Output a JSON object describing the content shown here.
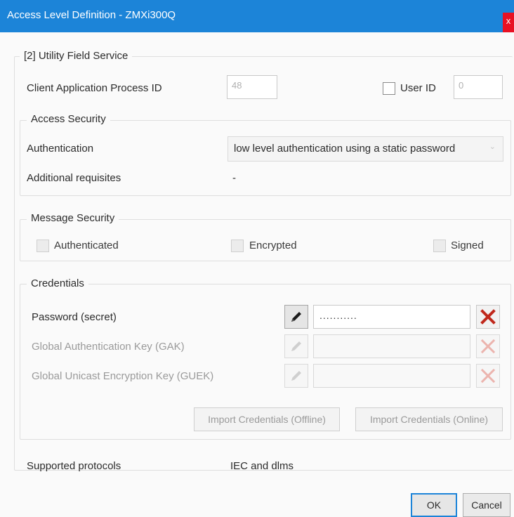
{
  "window": {
    "title": "Access Level Definition - ZMXi300Q",
    "close_symbol": "x"
  },
  "group_main": {
    "legend": "[2] Utility Field Service"
  },
  "client_app": {
    "label": "Client Application Process ID",
    "value": "48"
  },
  "user_id": {
    "label": "User ID",
    "value": "0",
    "checked": false
  },
  "access_security": {
    "legend": "Access Security",
    "authentication_label": "Authentication",
    "authentication_value": "low level authentication using a static password",
    "requisites_label": "Additional requisites",
    "requisites_value": "-"
  },
  "message_security": {
    "legend": "Message Security",
    "authenticated": "Authenticated",
    "encrypted": "Encrypted",
    "signed": "Signed"
  },
  "credentials": {
    "legend": "Credentials",
    "rows": [
      {
        "label": "Password (secret)",
        "value": "...........",
        "enabled": true
      },
      {
        "label": "Global Authentication Key (GAK)",
        "value": "",
        "enabled": false
      },
      {
        "label": "Global Unicast Encryption Key (GUEK)",
        "value": "",
        "enabled": false
      }
    ],
    "import_offline": "Import Credentials (Offline)",
    "import_online": "Import Credentials (Online)"
  },
  "protocols": {
    "label": "Supported protocols",
    "value": "IEC and dlms"
  },
  "buttons": {
    "ok": "OK",
    "cancel": "Cancel"
  },
  "icons": {
    "edit": "pencil-icon",
    "clear": "red-x-icon"
  },
  "colors": {
    "titlebar": "#1c84d8",
    "clear_red": "#c0281c",
    "close_red": "#e81123"
  }
}
